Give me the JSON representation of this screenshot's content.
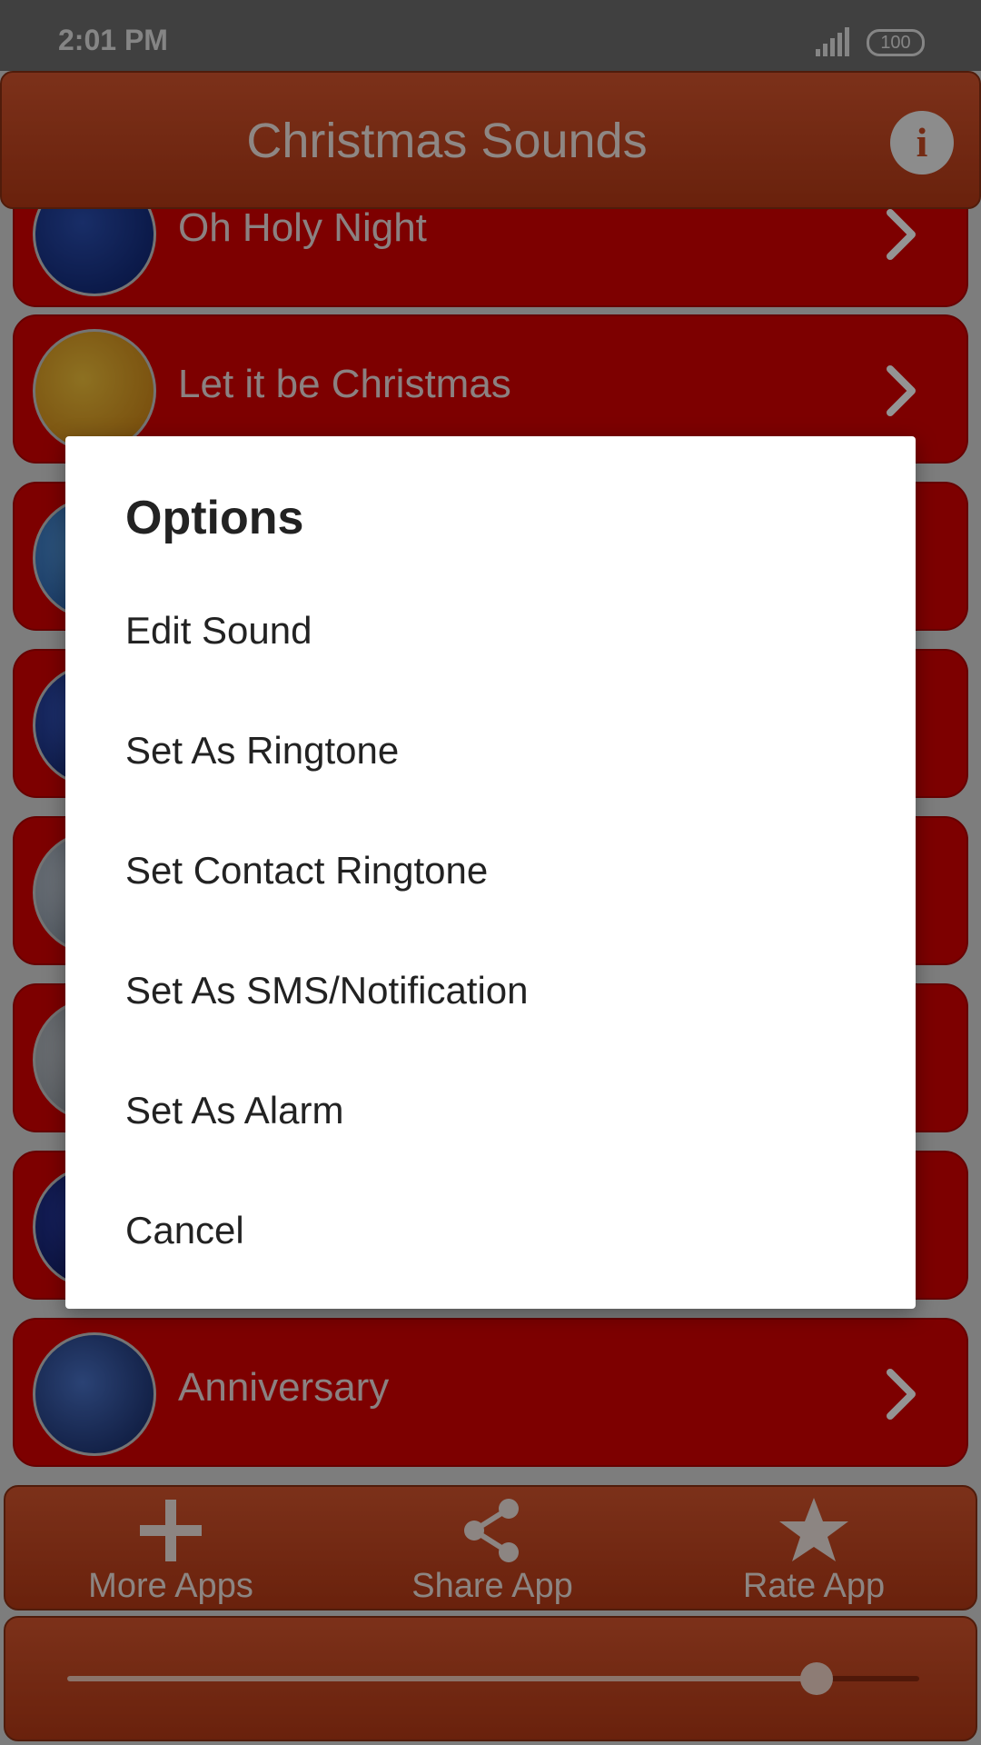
{
  "status_bar": {
    "time": "2:01 PM",
    "battery": "100",
    "icons": [
      "signal-icon",
      "battery-icon"
    ]
  },
  "header": {
    "title": "Christmas Sounds",
    "info_icon": "info-icon",
    "info_glyph": "i"
  },
  "sounds": [
    {
      "label": "Oh Holy Night",
      "thumb_colors": [
        "#2b4fb2",
        "#0b1f6a"
      ]
    },
    {
      "label": "Let it be Christmas",
      "thumb_colors": [
        "#f3c23a",
        "#c97b10"
      ]
    },
    {
      "label": "",
      "thumb_colors": [
        "#5aa2e6",
        "#1d4f9b"
      ]
    },
    {
      "label": "",
      "thumb_colors": [
        "#3a5ed0",
        "#0b1a5a"
      ]
    },
    {
      "label": "",
      "thumb_colors": [
        "#c9d2dd",
        "#7a8796"
      ]
    },
    {
      "label": "",
      "thumb_colors": [
        "#c7ccd2",
        "#8a929b"
      ]
    },
    {
      "label": "",
      "thumb_colors": [
        "#2b3fae",
        "#0b1452"
      ]
    },
    {
      "label": "Anniversary",
      "thumb_colors": [
        "#4a73c9",
        "#12245e"
      ]
    }
  ],
  "bottom_bar": {
    "more_apps": "More Apps",
    "share_app": "Share App",
    "rate_app": "Rate App",
    "icons": [
      "plus-icon",
      "share-icon",
      "star-icon"
    ]
  },
  "player": {
    "progress": 0.88
  },
  "dialog": {
    "title": "Options",
    "options": [
      "Edit Sound",
      "Set As Ringtone",
      "Set Contact Ringtone",
      "Set As SMS/Notification",
      "Set As Alarm",
      "Cancel"
    ]
  },
  "colors": {
    "header": "#c94a24",
    "list_item": "#d80000",
    "overlay": "rgba(0,0,0,0.42)",
    "dialog_bg": "#ffffff"
  }
}
